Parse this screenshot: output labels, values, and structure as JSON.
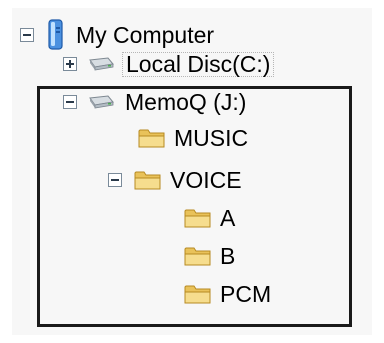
{
  "tree": {
    "root": {
      "label": "My Computer",
      "icon": "computer-icon",
      "expander": "collapse"
    },
    "drives": [
      {
        "label": "Local Disc(C:)",
        "icon": "drive-icon",
        "expander": "expand"
      },
      {
        "label": "MemoQ (J:)",
        "icon": "drive-icon",
        "expander": "collapse"
      }
    ],
    "folders": [
      {
        "label": "MUSIC",
        "icon": "folder-icon"
      },
      {
        "label": "VOICE",
        "icon": "folder-icon",
        "expander": "collapse"
      },
      {
        "label": "A",
        "icon": "folder-icon"
      },
      {
        "label": "B",
        "icon": "folder-icon"
      },
      {
        "label": "PCM",
        "icon": "folder-icon"
      }
    ]
  }
}
